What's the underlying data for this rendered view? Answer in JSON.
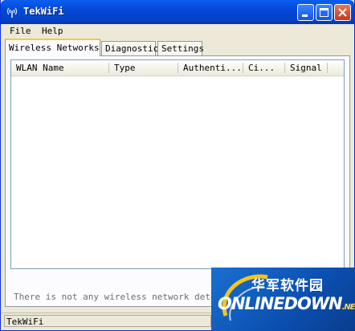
{
  "window": {
    "title": "TekWiFi"
  },
  "menu": {
    "items": [
      "File",
      "Help"
    ]
  },
  "tabs": [
    "Wireless Networks",
    "Diagnostic",
    "Settings"
  ],
  "table": {
    "columns": [
      "WLAN Name",
      "Type",
      "Authenti...",
      "Ci...",
      "Signal"
    ],
    "rows": []
  },
  "status_message": "There is not any wireless network detected.",
  "statusbar": {
    "text": "TekWiFi"
  },
  "watermark": {
    "chinese": "华军软件园",
    "brand": "ONLINEDOWN",
    "suffix": ".NET"
  },
  "colors": {
    "titlebar": "#0547d8",
    "window_bg": "#ece9d8",
    "active_tab_accent": "#ffc83c"
  },
  "icons": {
    "app": "wifi-antenna-icon",
    "minimize": "minimize-icon",
    "maximize": "maximize-icon",
    "close": "close-icon"
  }
}
